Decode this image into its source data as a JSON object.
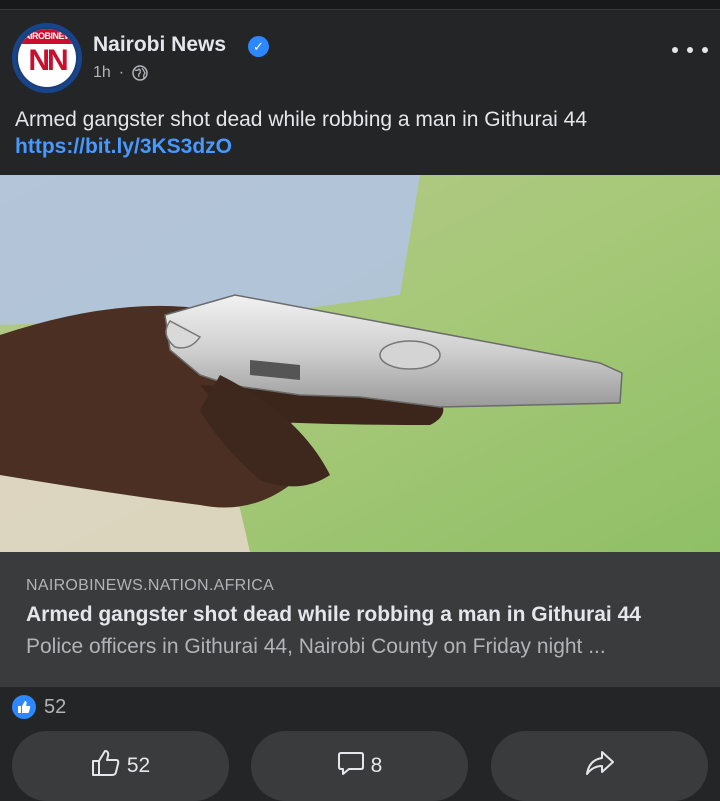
{
  "post": {
    "page_name": "Nairobi News",
    "logo_text": "NAIROBINEWS",
    "logo_mark": "NN",
    "time": "1h",
    "separator": "·",
    "caption": "Armed gangster shot dead while robbing a man in Githurai 44",
    "link": "https://bit.ly/3KS3dzO"
  },
  "preview": {
    "domain": "NAIROBINEWS.NATION.AFRICA",
    "headline": "Armed gangster shot dead while robbing a man in Githurai 44",
    "description": "Police officers in Githurai 44, Nairobi County on Friday night ..."
  },
  "reactions": {
    "count": "52"
  },
  "actions": {
    "like_count": "52",
    "comment_count": "8"
  },
  "colors": {
    "background": "#242526",
    "preview_bg": "#3a3b3c",
    "link": "#4599ff",
    "accent": "#2d88ff"
  }
}
